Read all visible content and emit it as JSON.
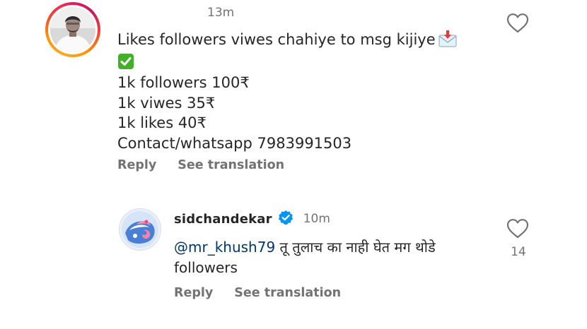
{
  "comment": {
    "timestamp": "13m",
    "lines": [
      "Likes followers viwes chahiye to msg kijiye",
      "",
      "1k followers 100₹",
      "1k viwes 35₹",
      "1k likes 40₹",
      "Contact/whatsapp 7983991503"
    ],
    "reply_label": "Reply",
    "see_translation_label": "See translation"
  },
  "reply": {
    "username": "sidchandekar",
    "timestamp": "10m",
    "mention": "@mr_khush79",
    "text_line1": " तू तुलाच का नाही घेत मग थोडे",
    "text_line2": "followers",
    "like_count": "14",
    "reply_label": "Reply",
    "see_translation_label": "See translation"
  },
  "icons": {
    "inbox_emoji": "envelope-with-arrow-icon",
    "check_emoji": "white-check-mark-icon",
    "like": "heart-outline-icon",
    "verified": "verified-badge-icon"
  },
  "colors": {
    "text": "#262626",
    "secondary": "#737373",
    "mention": "#00376b",
    "verified": "#0095f6",
    "check_green": "#43b02a"
  }
}
